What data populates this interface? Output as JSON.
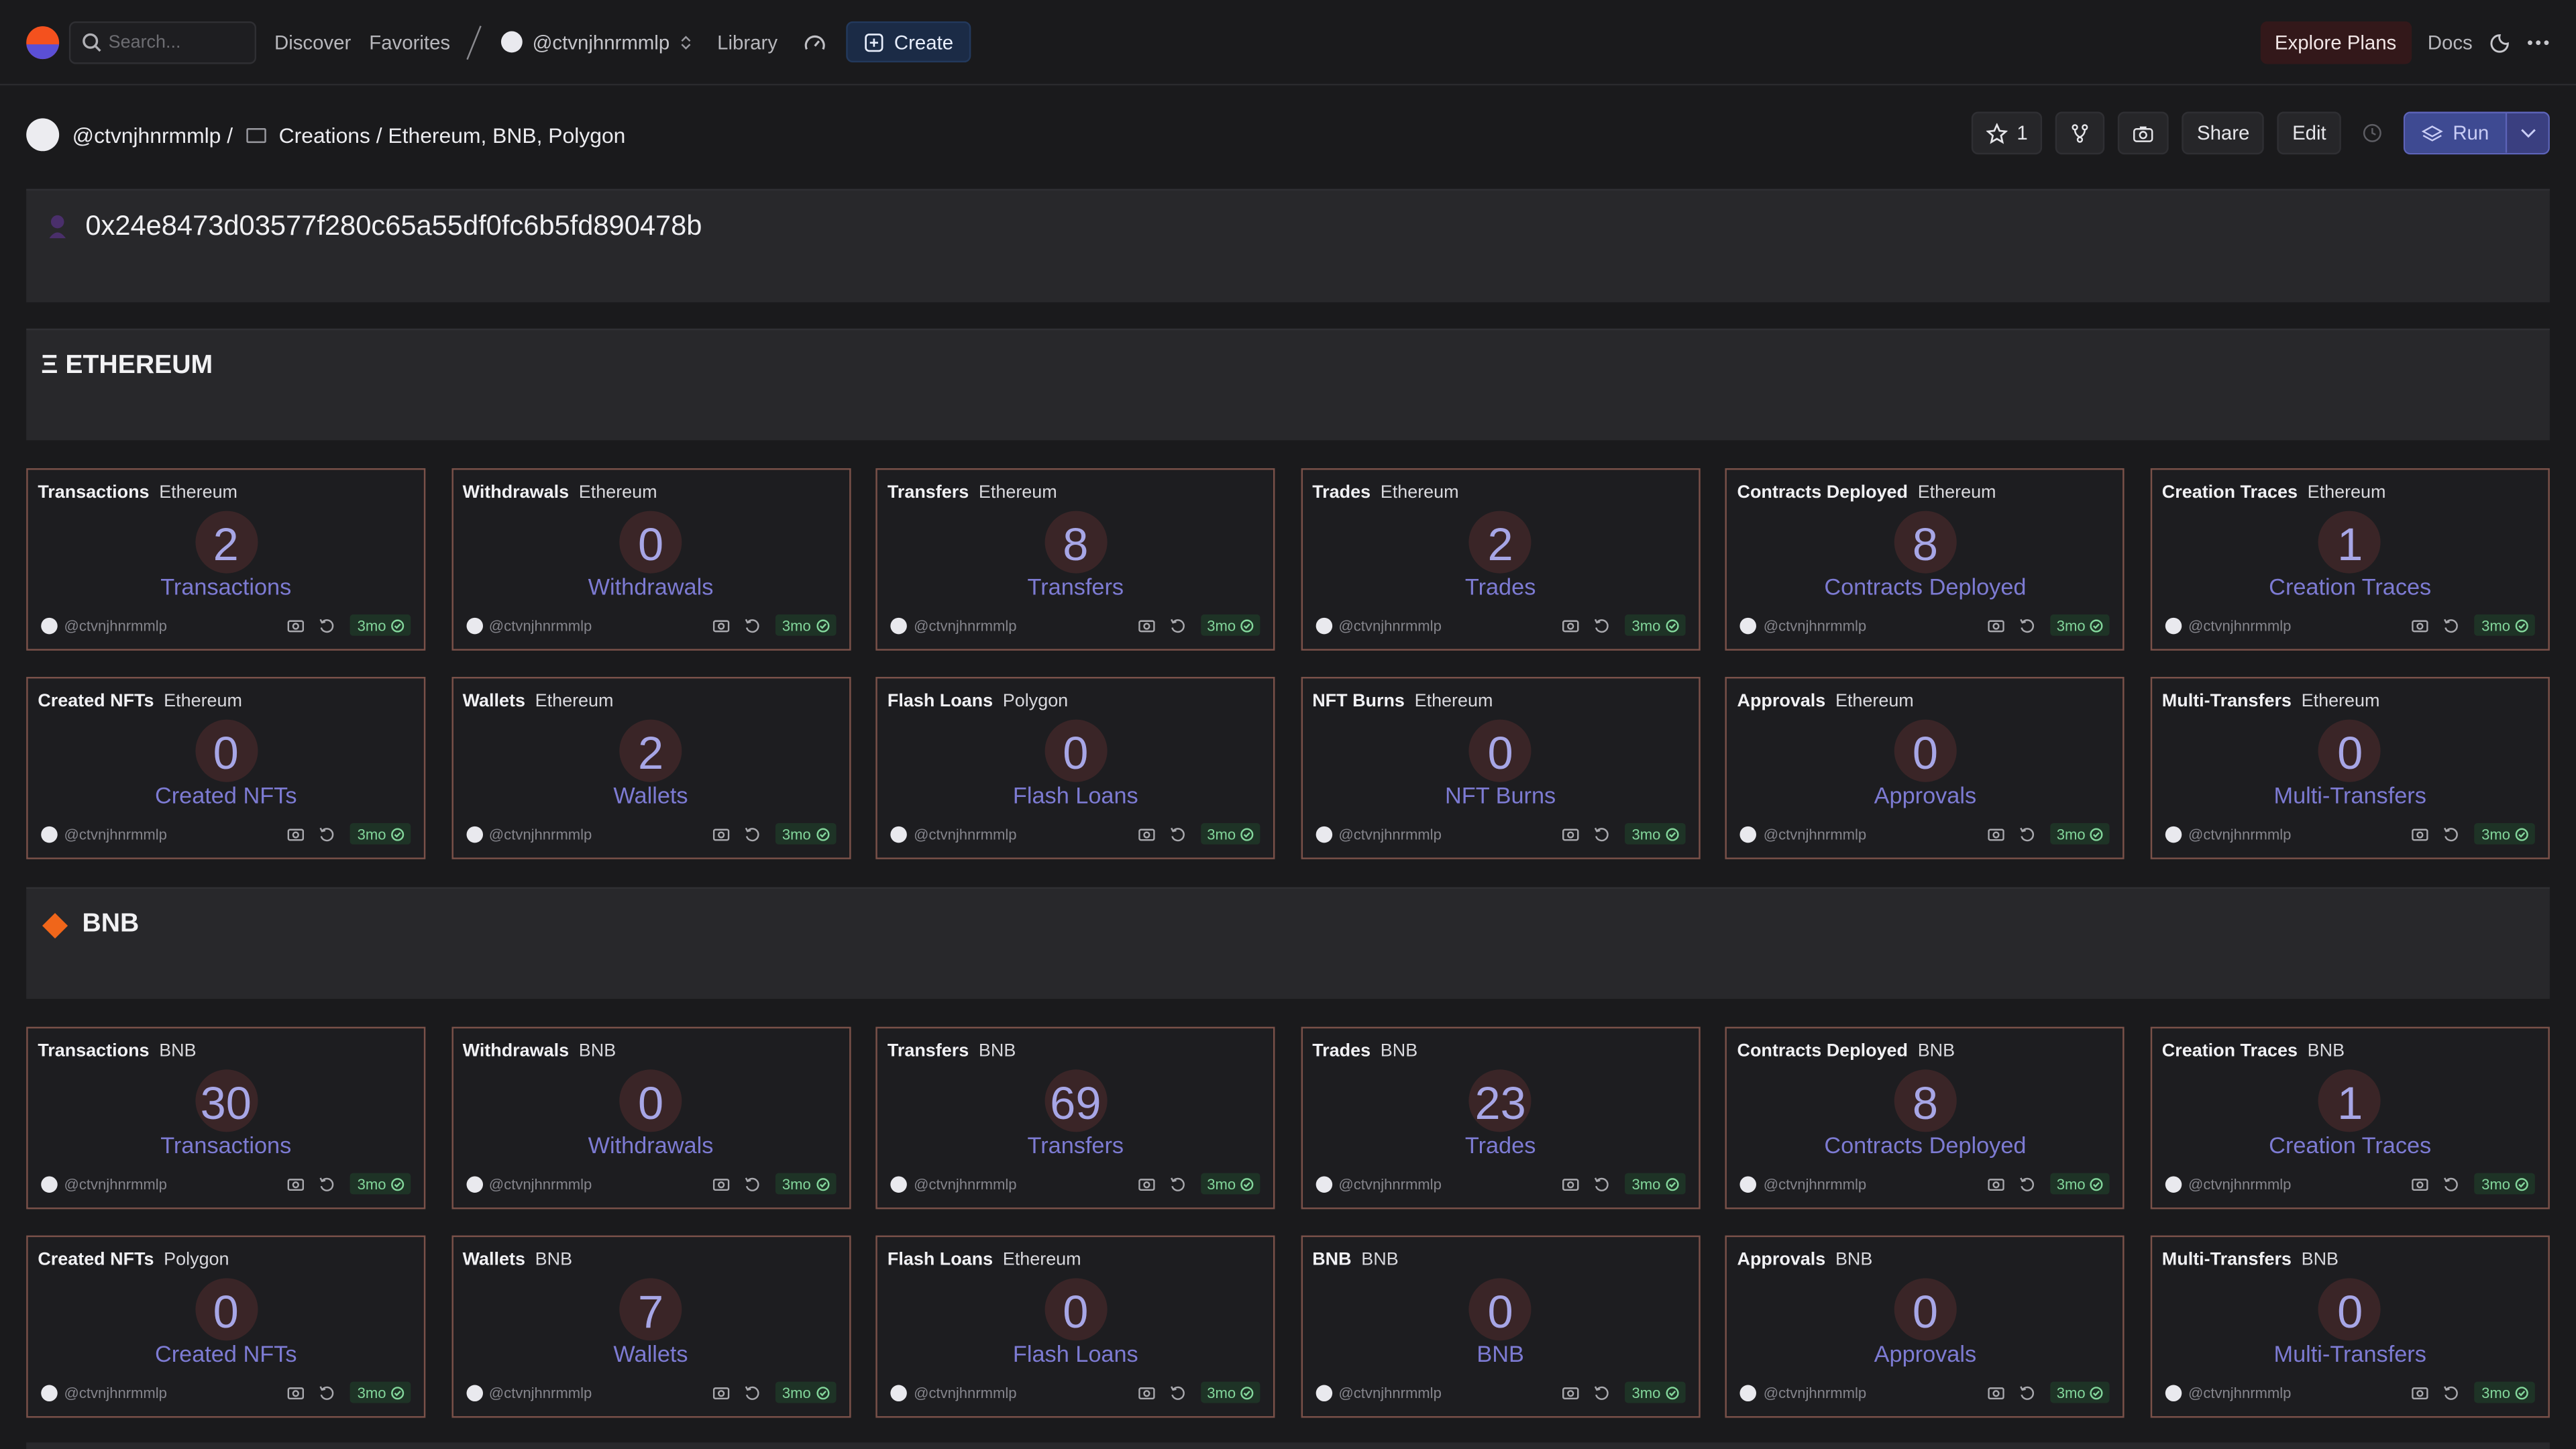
{
  "topbar": {
    "search_placeholder": "Search...",
    "discover": "Discover",
    "favorites": "Favorites",
    "user": "@ctvnjhnrmmlp",
    "library": "Library",
    "create": "Create",
    "explore": "Explore Plans",
    "docs": "Docs"
  },
  "breadcrumb": {
    "user": "@ctvnjhnrmmlp /",
    "path": "Creations / Ethereum, BNB, Polygon"
  },
  "actions": {
    "star_count": "1",
    "share": "Share",
    "edit": "Edit",
    "run": "Run"
  },
  "address": {
    "title": "0x24e8473d03577f280c65a55df0fc6b5fd890478b"
  },
  "sections": {
    "ethereum": "Ξ ETHEREUM",
    "bnb": "BNB"
  },
  "tile_owner": "@ctvnjhnrmmlp",
  "tile_age": "3mo",
  "ethereum_tiles": [
    {
      "name": "Transactions",
      "chain": "Ethereum",
      "value": "2",
      "label": "Transactions"
    },
    {
      "name": "Withdrawals",
      "chain": "Ethereum",
      "value": "0",
      "label": "Withdrawals"
    },
    {
      "name": "Transfers",
      "chain": "Ethereum",
      "value": "8",
      "label": "Transfers"
    },
    {
      "name": "Trades",
      "chain": "Ethereum",
      "value": "2",
      "label": "Trades"
    },
    {
      "name": "Contracts Deployed",
      "chain": "Ethereum",
      "value": "8",
      "label": "Contracts Deployed"
    },
    {
      "name": "Creation Traces",
      "chain": "Ethereum",
      "value": "1",
      "label": "Creation Traces"
    },
    {
      "name": "Created NFTs",
      "chain": "Ethereum",
      "value": "0",
      "label": "Created NFTs"
    },
    {
      "name": "Wallets",
      "chain": "Ethereum",
      "value": "2",
      "label": "Wallets"
    },
    {
      "name": "Flash Loans",
      "chain": "Polygon",
      "value": "0",
      "label": "Flash Loans"
    },
    {
      "name": "NFT Burns",
      "chain": "Ethereum",
      "value": "0",
      "label": "NFT Burns"
    },
    {
      "name": "Approvals",
      "chain": "Ethereum",
      "value": "0",
      "label": "Approvals"
    },
    {
      "name": "Multi-Transfers",
      "chain": "Ethereum",
      "value": "0",
      "label": "Multi-Transfers"
    }
  ],
  "bnb_tiles": [
    {
      "name": "Transactions",
      "chain": "BNB",
      "value": "30",
      "label": "Transactions"
    },
    {
      "name": "Withdrawals",
      "chain": "BNB",
      "value": "0",
      "label": "Withdrawals"
    },
    {
      "name": "Transfers",
      "chain": "BNB",
      "value": "69",
      "label": "Transfers"
    },
    {
      "name": "Trades",
      "chain": "BNB",
      "value": "23",
      "label": "Trades"
    },
    {
      "name": "Contracts Deployed",
      "chain": "BNB",
      "value": "8",
      "label": "Contracts Deployed"
    },
    {
      "name": "Creation Traces",
      "chain": "BNB",
      "value": "1",
      "label": "Creation Traces"
    },
    {
      "name": "Created NFTs",
      "chain": "Polygon",
      "value": "0",
      "label": "Created NFTs"
    },
    {
      "name": "Wallets",
      "chain": "BNB",
      "value": "7",
      "label": "Wallets"
    },
    {
      "name": "Flash Loans",
      "chain": "Ethereum",
      "value": "0",
      "label": "Flash Loans"
    },
    {
      "name": "BNB",
      "chain": "BNB",
      "value": "0",
      "label": "BNB"
    },
    {
      "name": "Approvals",
      "chain": "BNB",
      "value": "0",
      "label": "Approvals"
    },
    {
      "name": "Multi-Transfers",
      "chain": "BNB",
      "value": "0",
      "label": "Multi-Transfers"
    }
  ],
  "colors": {
    "accent": "#5b4fd6",
    "brand": "#f4511e",
    "tile_border": "#7a5149",
    "badge_green": "#83d69b",
    "bnb": "#f0661a"
  }
}
